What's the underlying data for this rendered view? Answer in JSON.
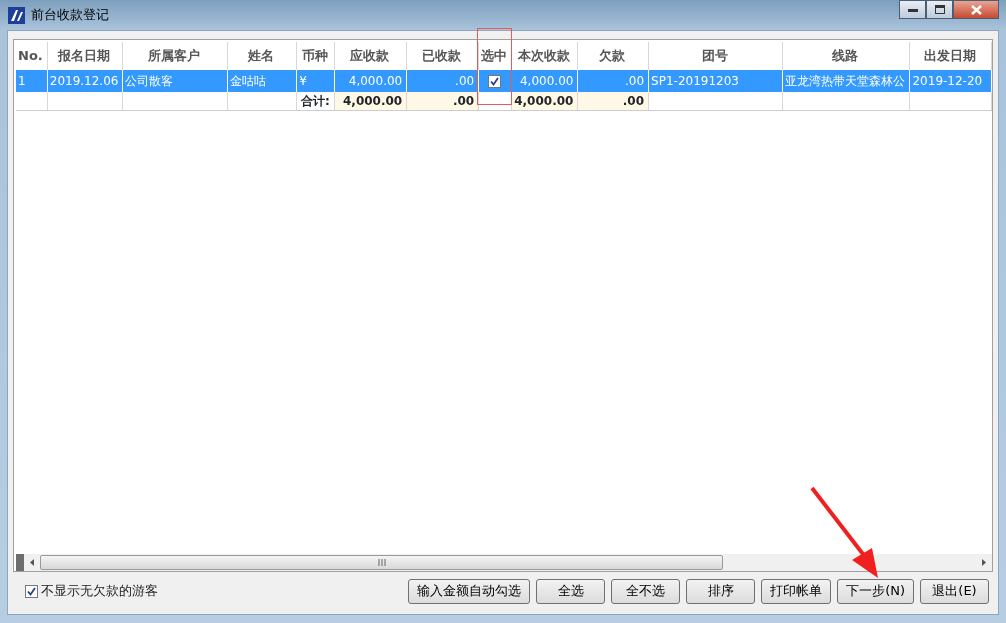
{
  "window": {
    "title": "前台收款登记"
  },
  "table": {
    "columns": [
      {
        "label": "No.",
        "kind": "text"
      },
      {
        "label": "报名日期",
        "kind": "text"
      },
      {
        "label": "所属客户",
        "kind": "text"
      },
      {
        "label": "姓名",
        "kind": "text"
      },
      {
        "label": "币种",
        "kind": "text",
        "total": "合计:"
      },
      {
        "label": "应收款",
        "kind": "number",
        "total": "4,000.00"
      },
      {
        "label": "已收款",
        "kind": "number",
        "total": ".00"
      },
      {
        "label": "选中",
        "kind": "checkbox"
      },
      {
        "label": "本次收款",
        "kind": "number",
        "total": "4,000.00"
      },
      {
        "label": "欠款",
        "kind": "number",
        "total": ".00"
      },
      {
        "label": "团号",
        "kind": "text"
      },
      {
        "label": "线路",
        "kind": "text"
      },
      {
        "label": "出发日期",
        "kind": "text"
      }
    ],
    "rows": [
      {
        "selected": true,
        "checked": true,
        "cells": [
          "1",
          "2019.12.06",
          "公司散客",
          "金咕咕",
          "¥",
          "4,000.00",
          ".00",
          "",
          "4,000.00",
          ".00",
          "SP1-20191203",
          "亚龙湾热带天堂森林公",
          "2019-12-20"
        ]
      }
    ]
  },
  "options": [
    {
      "label": "不显示无欠款的游客",
      "checked": true
    }
  ],
  "buttons": [
    "输入金额自动勾选",
    "全选",
    "全不选",
    "排序",
    "打印帐单",
    "下一步(N)",
    "退出(E)"
  ]
}
